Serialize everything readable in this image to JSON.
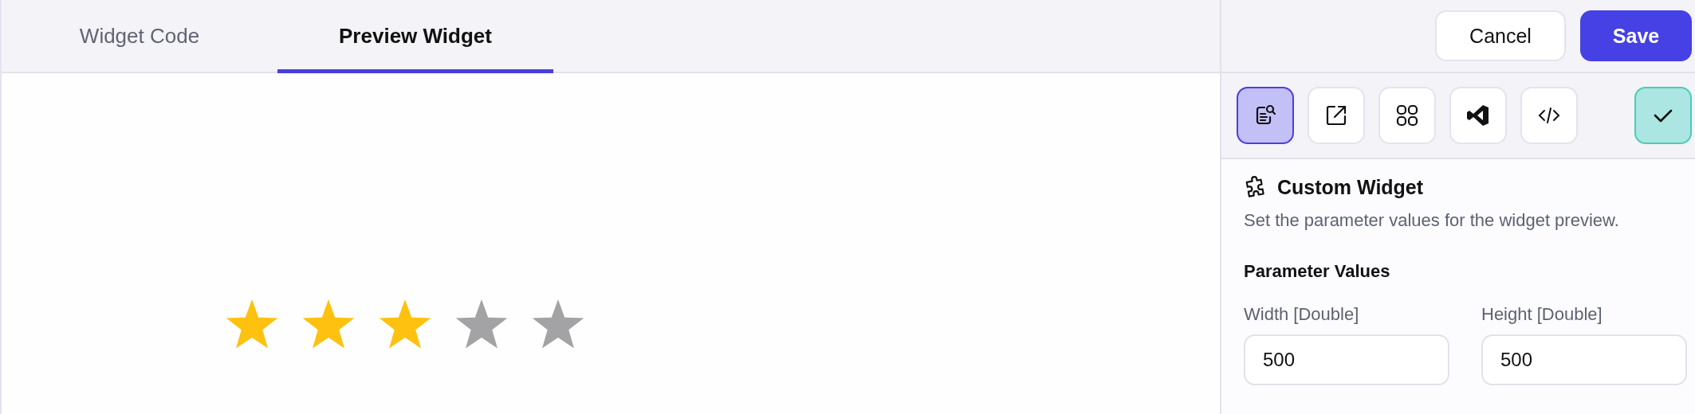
{
  "tabs": [
    {
      "label": "Widget Code",
      "selected": false
    },
    {
      "label": "Preview Widget",
      "selected": true
    }
  ],
  "preview": {
    "rating": {
      "stars": 3
    }
  },
  "header_buttons": [
    {
      "label": "Cancel",
      "kind": "secondary"
    },
    {
      "label": "Save",
      "kind": "primary"
    }
  ],
  "toolbar": [
    {
      "kind": "doc-search",
      "selected": true
    },
    {
      "kind": "export",
      "selected": false
    },
    {
      "kind": "grid",
      "selected": false
    },
    {
      "kind": "vscode",
      "selected": false
    },
    {
      "kind": "code",
      "selected": false
    }
  ],
  "panel": {
    "title": "Custom Widget",
    "description": "Set the parameter values for the widget preview.",
    "section": "Parameter Values",
    "fields": [
      {
        "label": "Width [Double]",
        "value": "500"
      },
      {
        "label": "Height [Double]",
        "value": "500"
      }
    ]
  }
}
